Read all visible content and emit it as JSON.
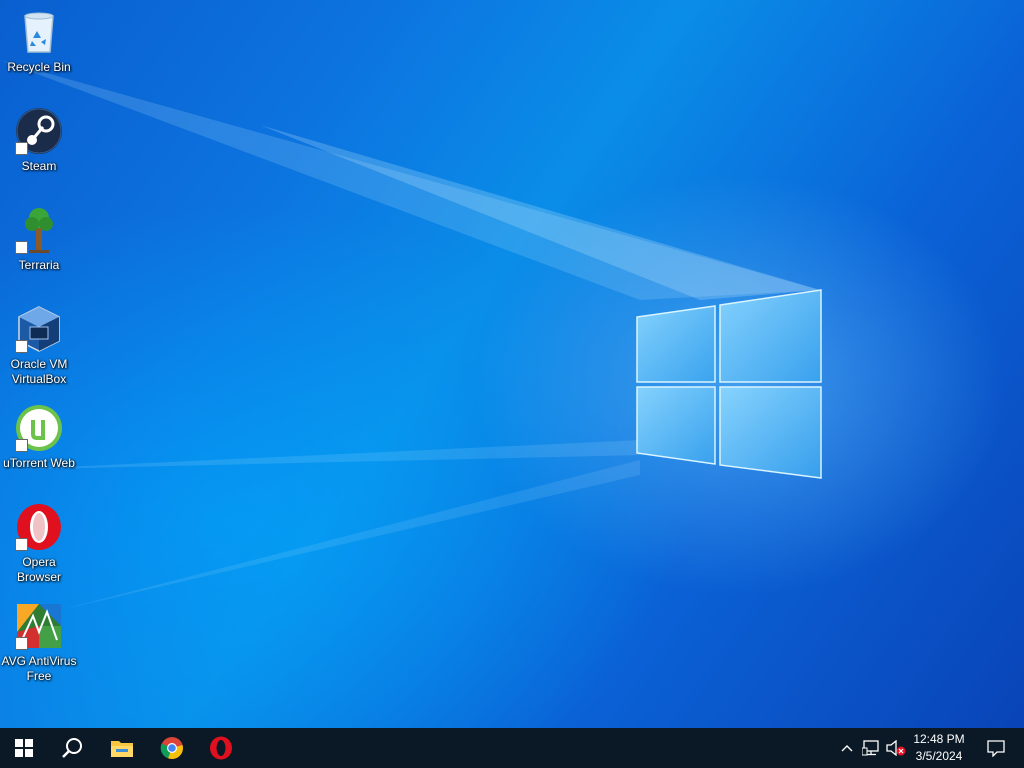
{
  "desktop": {
    "icons": [
      {
        "label": "Recycle Bin",
        "icon": "recycle-bin-icon"
      },
      {
        "label": "Steam",
        "icon": "steam-icon"
      },
      {
        "label": "Terraria",
        "icon": "terraria-icon"
      },
      {
        "label": "Oracle VM VirtualBox",
        "icon": "virtualbox-icon"
      },
      {
        "label": "uTorrent Web",
        "icon": "utorrent-icon"
      },
      {
        "label": "Opera Browser",
        "icon": "opera-icon"
      },
      {
        "label": "AVG AntiVirus Free",
        "icon": "avg-icon"
      }
    ]
  },
  "taskbar": {
    "start": "windows-start-icon",
    "search": "search-icon",
    "pinned": [
      {
        "name": "File Explorer",
        "icon": "file-explorer-icon"
      },
      {
        "name": "Google Chrome",
        "icon": "chrome-icon"
      },
      {
        "name": "Opera",
        "icon": "opera-icon"
      }
    ],
    "tray": {
      "show_hidden": "chevron-up-icon",
      "network": "network-icon",
      "volume": "volume-muted-icon",
      "time": "12:48 PM",
      "date": "3/5/2024",
      "notifications": "action-center-icon"
    }
  },
  "colors": {
    "taskbar": "#0b1826",
    "wallpaper_accent": "#0a78e0"
  }
}
